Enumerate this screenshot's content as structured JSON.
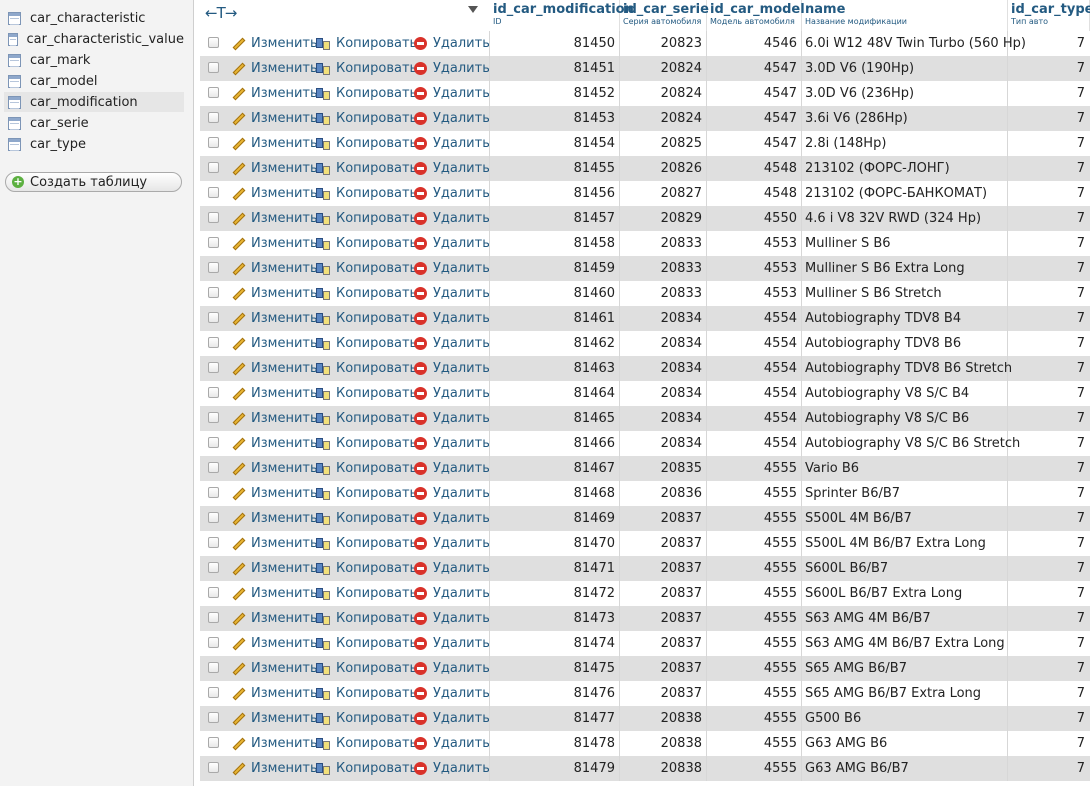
{
  "sidebar": {
    "tables": [
      {
        "label": "car_characteristic",
        "active": false
      },
      {
        "label": "car_characteristic_value",
        "active": false
      },
      {
        "label": "car_mark",
        "active": false
      },
      {
        "label": "car_model",
        "active": false
      },
      {
        "label": "car_modification",
        "active": true
      },
      {
        "label": "car_serie",
        "active": false
      },
      {
        "label": "car_type",
        "active": false
      }
    ],
    "create_label": "Создать таблицу"
  },
  "header": {
    "arrows": "←T→",
    "columns": [
      {
        "title": "id_car_modification",
        "sub": "ID"
      },
      {
        "title": "id_car_serie",
        "sub": "Серия автомобиля"
      },
      {
        "title": "id_car_model",
        "sub": "Модель автомобиля"
      },
      {
        "title": "name",
        "sub": "Название модификации"
      },
      {
        "title": "id_car_type",
        "sub": "Тип авто"
      }
    ]
  },
  "actions": {
    "edit": "Изменить",
    "copy": "Копировать",
    "delete": "Удалить"
  },
  "rows": [
    {
      "id": "81450",
      "serie": "20823",
      "model": "4546",
      "name": "6.0i W12 48V Twin Turbo (560 Hp)",
      "type": "7"
    },
    {
      "id": "81451",
      "serie": "20824",
      "model": "4547",
      "name": "3.0D V6 (190Hp)",
      "type": "7"
    },
    {
      "id": "81452",
      "serie": "20824",
      "model": "4547",
      "name": "3.0D V6 (236Hp)",
      "type": "7"
    },
    {
      "id": "81453",
      "serie": "20824",
      "model": "4547",
      "name": "3.6i V6 (286Hp)",
      "type": "7"
    },
    {
      "id": "81454",
      "serie": "20825",
      "model": "4547",
      "name": "2.8i (148Hp)",
      "type": "7"
    },
    {
      "id": "81455",
      "serie": "20826",
      "model": "4548",
      "name": "213102 (ФОРС-ЛОНГ)",
      "type": "7"
    },
    {
      "id": "81456",
      "serie": "20827",
      "model": "4548",
      "name": "213102 (ФОРС-БАНКОМАТ)",
      "type": "7"
    },
    {
      "id": "81457",
      "serie": "20829",
      "model": "4550",
      "name": "4.6 i V8 32V RWD (324 Hp)",
      "type": "7"
    },
    {
      "id": "81458",
      "serie": "20833",
      "model": "4553",
      "name": "Mulliner S B6",
      "type": "7"
    },
    {
      "id": "81459",
      "serie": "20833",
      "model": "4553",
      "name": "Mulliner S B6 Extra Long",
      "type": "7"
    },
    {
      "id": "81460",
      "serie": "20833",
      "model": "4553",
      "name": "Mulliner S B6 Stretch",
      "type": "7"
    },
    {
      "id": "81461",
      "serie": "20834",
      "model": "4554",
      "name": "Autobiography TDV8 B4",
      "type": "7"
    },
    {
      "id": "81462",
      "serie": "20834",
      "model": "4554",
      "name": "Autobiography TDV8 B6",
      "type": "7"
    },
    {
      "id": "81463",
      "serie": "20834",
      "model": "4554",
      "name": "Autobiography TDV8 B6 Stretch",
      "type": "7"
    },
    {
      "id": "81464",
      "serie": "20834",
      "model": "4554",
      "name": "Autobiography V8 S/C B4",
      "type": "7"
    },
    {
      "id": "81465",
      "serie": "20834",
      "model": "4554",
      "name": "Autobiography V8 S/C B6",
      "type": "7"
    },
    {
      "id": "81466",
      "serie": "20834",
      "model": "4554",
      "name": "Autobiography V8 S/C B6 Stretch",
      "type": "7"
    },
    {
      "id": "81467",
      "serie": "20835",
      "model": "4555",
      "name": "Vario B6",
      "type": "7"
    },
    {
      "id": "81468",
      "serie": "20836",
      "model": "4555",
      "name": "Sprinter B6/B7",
      "type": "7"
    },
    {
      "id": "81469",
      "serie": "20837",
      "model": "4555",
      "name": "S500L 4M B6/B7",
      "type": "7"
    },
    {
      "id": "81470",
      "serie": "20837",
      "model": "4555",
      "name": "S500L 4M B6/B7 Extra Long",
      "type": "7"
    },
    {
      "id": "81471",
      "serie": "20837",
      "model": "4555",
      "name": "S600L B6/B7",
      "type": "7"
    },
    {
      "id": "81472",
      "serie": "20837",
      "model": "4555",
      "name": "S600L B6/B7 Extra Long",
      "type": "7"
    },
    {
      "id": "81473",
      "serie": "20837",
      "model": "4555",
      "name": "S63 AMG 4M B6/B7",
      "type": "7"
    },
    {
      "id": "81474",
      "serie": "20837",
      "model": "4555",
      "name": "S63 AMG 4M B6/B7 Extra Long",
      "type": "7"
    },
    {
      "id": "81475",
      "serie": "20837",
      "model": "4555",
      "name": "S65 AMG B6/B7",
      "type": "7"
    },
    {
      "id": "81476",
      "serie": "20837",
      "model": "4555",
      "name": "S65 AMG B6/B7 Extra Long",
      "type": "7"
    },
    {
      "id": "81477",
      "serie": "20838",
      "model": "4555",
      "name": "G500 B6",
      "type": "7"
    },
    {
      "id": "81478",
      "serie": "20838",
      "model": "4555",
      "name": "G63 AMG B6",
      "type": "7"
    },
    {
      "id": "81479",
      "serie": "20838",
      "model": "4555",
      "name": "G63 AMG B6/B7",
      "type": "7"
    }
  ]
}
